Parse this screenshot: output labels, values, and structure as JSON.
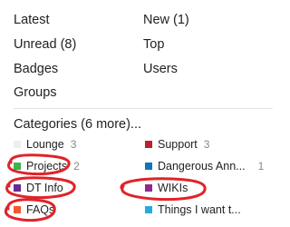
{
  "nav": {
    "latest": "Latest",
    "new": "New (1)",
    "unread": "Unread (8)",
    "top": "Top",
    "badges": "Badges",
    "users": "Users",
    "groups": "Groups"
  },
  "categories": {
    "header": "Categories (6 more)...",
    "items": [
      {
        "name": "Lounge",
        "count": "3",
        "color": "#eeeeee"
      },
      {
        "name": "Support",
        "count": "3",
        "color": "#bf1e2e"
      },
      {
        "name": "Projects",
        "count": "2",
        "color": "#3ab54a"
      },
      {
        "name": "Dangerous Ann...",
        "count": "1",
        "color": "#0e76bd"
      },
      {
        "name": "DT Info",
        "count": "",
        "color": "#652d90"
      },
      {
        "name": "WIKIs",
        "count": "",
        "color": "#92278f"
      },
      {
        "name": "FAQs",
        "count": "",
        "color": "#f1592a"
      },
      {
        "name": "Things I want t...",
        "count": "",
        "color": "#25aae2"
      }
    ]
  },
  "annotation_color": "#e0232a"
}
